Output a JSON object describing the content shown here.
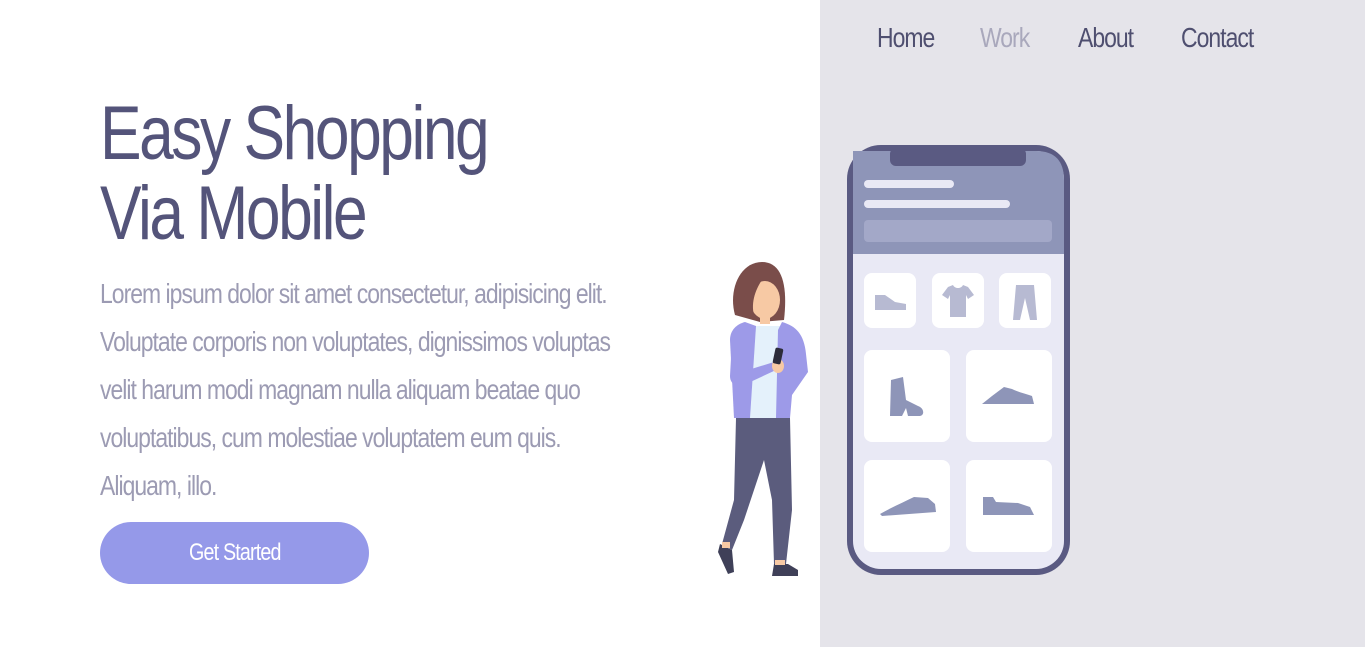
{
  "nav": {
    "items": [
      {
        "label": "Home"
      },
      {
        "label": "Work"
      },
      {
        "label": "About"
      },
      {
        "label": "Contact"
      }
    ],
    "active": "Work"
  },
  "hero": {
    "title_line1": "Easy Shopping",
    "title_line2": "Via Mobile",
    "body": "Lorem ipsum dolor sit amet consectetur, adipisicing elit. Voluptate corporis non voluptates, dignissimos voluptas velit harum modi magnam nulla aliquam beatae quo voluptatibus, cum molestiae voluptatem eum quis. Aliquam, illo.",
    "cta_label": "Get Started"
  },
  "colors": {
    "text_dark": "#54547a",
    "text_muted": "#9c9bb3",
    "accent": "#9599e9",
    "panel_bg": "#e5e4ea",
    "nav_active": "#a9a8bc"
  },
  "illustration": {
    "icons": [
      "shoe-icon",
      "tshirt-icon",
      "pants-icon",
      "boot-icon",
      "sneaker-icon",
      "sneaker-icon",
      "sneaker-icon"
    ]
  }
}
